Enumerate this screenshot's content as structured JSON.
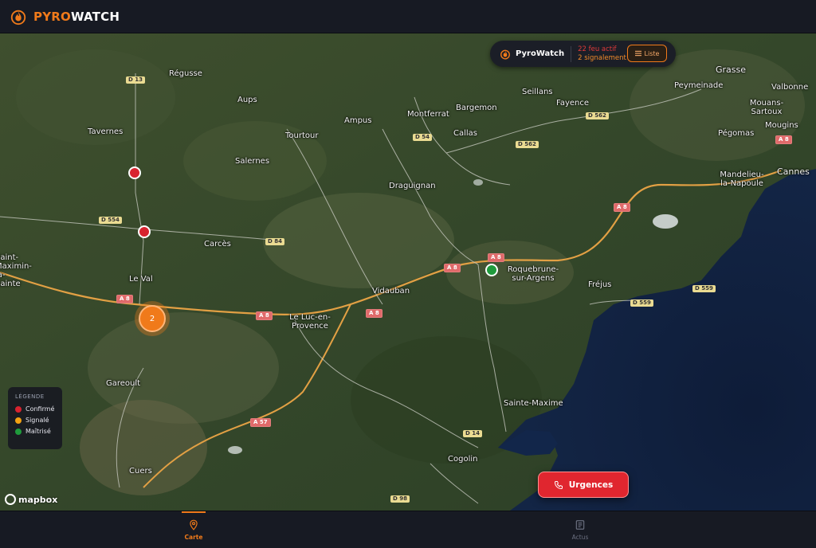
{
  "app": {
    "brand_part1": "PYRO",
    "brand_part2": "WATCH",
    "accent_color": "#f07a1a"
  },
  "status_pill": {
    "title": "PyroWatch",
    "active_fires": "22 feu actif",
    "reports": "2 signalement",
    "list_button": "Liste",
    "list_icon": "list-icon"
  },
  "legend": {
    "title": "LÉGENDE",
    "items": [
      {
        "label": "Confirmé",
        "color": "#d8232f"
      },
      {
        "label": "Signalé",
        "color": "#f2a112"
      },
      {
        "label": "Maîtrisé",
        "color": "#1f9b3c"
      }
    ]
  },
  "map": {
    "cluster_count": "2",
    "attribution_logo": "mapbox",
    "places": [
      "Régusse",
      "Aups",
      "Tavernes",
      "Salernes",
      "Tourtour",
      "Ampus",
      "Montferrat",
      "Bargemon",
      "Callas",
      "Seillans",
      "Fayence",
      "Grasse",
      "Valbonne",
      "Peymeinade",
      "Mouans-Sartoux",
      "Mougins",
      "Pégomas",
      "Mandelieu-la-Napoule",
      "Cannes",
      "Draguignan",
      "Carcès",
      "Le Val",
      "Vidauban",
      "Le Luc-en-Provence",
      "Roquebrune-sur-Argens",
      "Fréjus",
      "Gareoult",
      "Sainte-Maxime",
      "Cogolin",
      "Cuers",
      "Saint-Maximin-la-Sainte"
    ],
    "roads": [
      "D 13",
      "D 554",
      "D 84",
      "D 54",
      "D 562",
      "D 562",
      "A 8",
      "A 8",
      "A 8",
      "A 8",
      "A 8",
      "A 8",
      "A 8",
      "D 559",
      "D 559",
      "A 57",
      "D 14",
      "D 98"
    ]
  },
  "urgences_button": {
    "label": "Urgences",
    "icon": "phone-icon"
  },
  "bottom_nav": {
    "items": [
      {
        "label": "Carte",
        "icon": "map-pin-icon",
        "active": true
      },
      {
        "label": "Actus",
        "icon": "newspaper-icon",
        "active": false
      }
    ]
  }
}
